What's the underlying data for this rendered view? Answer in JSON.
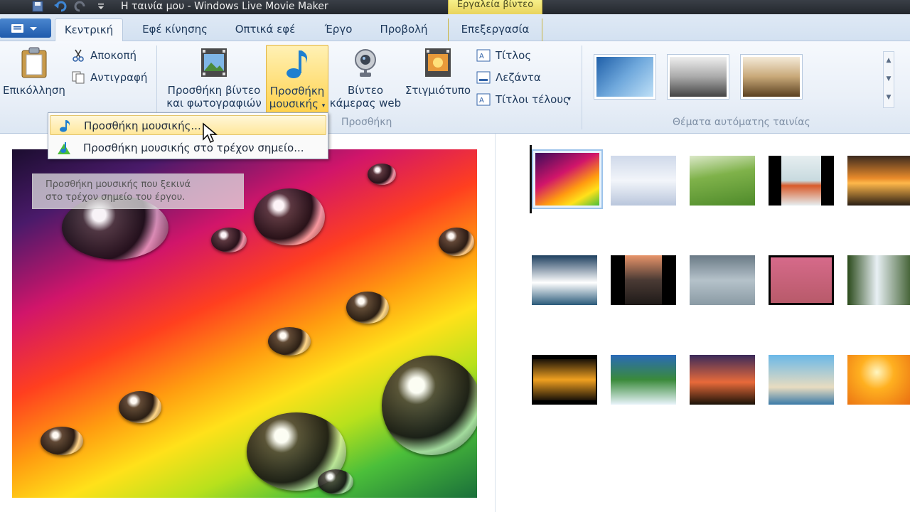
{
  "window": {
    "title": "Η ταινία μου - Windows Live Movie Maker",
    "context_tab_group": "Εργαλεία βίντεο"
  },
  "tabs": [
    {
      "label": "Κεντρική",
      "active": true
    },
    {
      "label": "Εφέ κίνησης"
    },
    {
      "label": "Οπτικά εφέ"
    },
    {
      "label": "Έργο"
    },
    {
      "label": "Προβολή"
    },
    {
      "label": "Επεξεργασία"
    }
  ],
  "ribbon": {
    "clipboard": {
      "paste": "Επικόλληση",
      "cut": "Αποκοπή",
      "copy": "Αντιγραφή"
    },
    "add": {
      "add_video_line1": "Προσθήκη βίντεο",
      "add_video_line2": "και φωτογραφιών",
      "add_music_line1": "Προσθήκη",
      "add_music_line2": "μουσικής",
      "webcam_line1": "Βίντεο",
      "webcam_line2": "κάμερας web",
      "snapshot": "Στιγμιότυπο",
      "title": "Τίτλος",
      "caption": "Λεζάντα",
      "credits": "Τίτλοι τέλους",
      "group_label": "Προσθήκη"
    },
    "themes": {
      "group_label": "Θέματα αυτόματης ταινίας"
    }
  },
  "menu": {
    "items": [
      {
        "label": "Προσθήκη μουσικής...",
        "hover": true
      },
      {
        "label": "Προσθήκη μουσικής στο τρέχον σημείο..."
      }
    ]
  },
  "tooltip": {
    "line1": "Προσθήκη μουσικής που ξεκινά",
    "line2": "στο τρέχον σημείο του έργου."
  },
  "colors": {
    "accent": "#1f5bac",
    "ribbon_bg": "#eaf0f8",
    "hover": "#ffe79b"
  }
}
